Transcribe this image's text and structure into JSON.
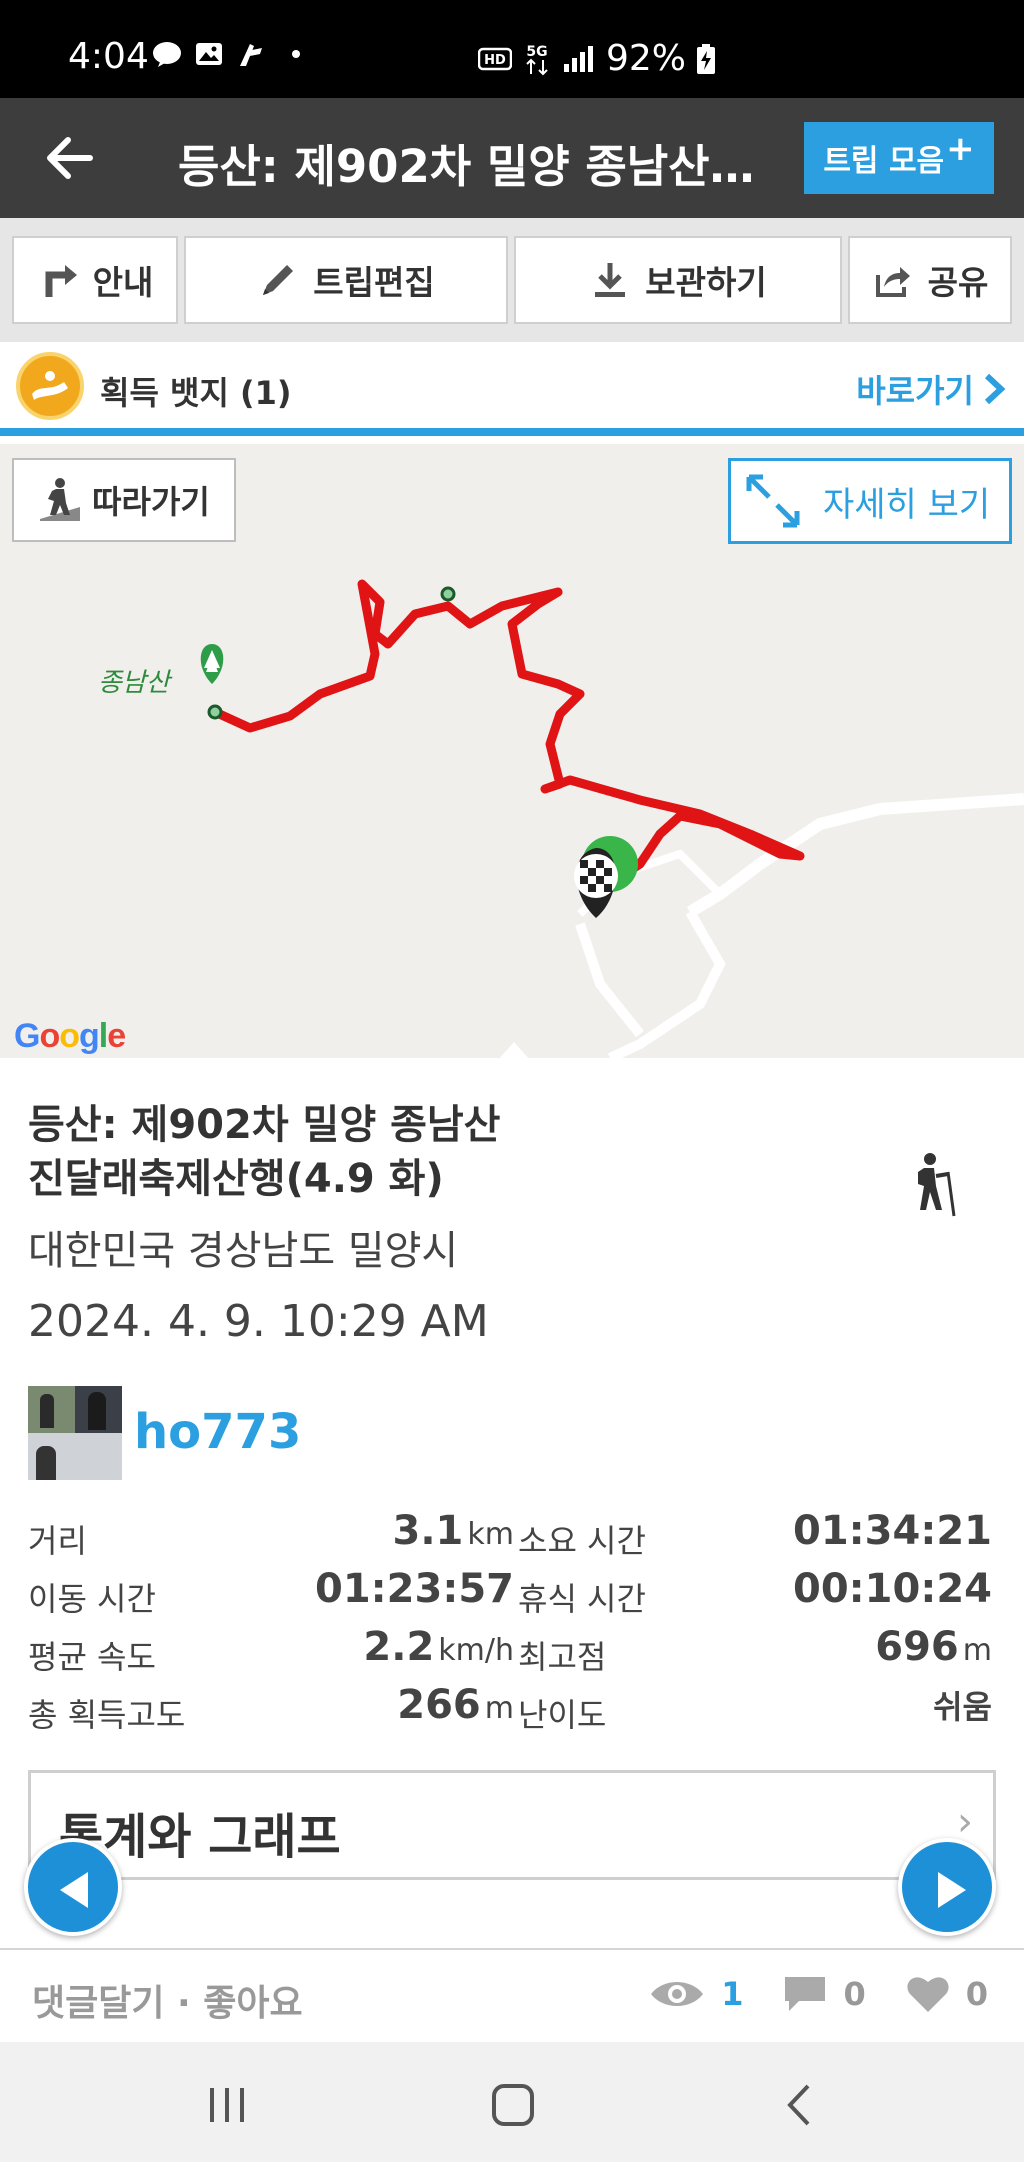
{
  "status_bar": {
    "time": "4:04",
    "battery": "92%",
    "network": "5G",
    "hd_label": "HD"
  },
  "header": {
    "title": "등산: 제902차 밀양 종남산...",
    "trip_collection_label": "트립 모음",
    "trip_collection_plus": "+"
  },
  "toolbar": {
    "guide": "안내",
    "edit": "트립편집",
    "save": "보관하기",
    "share": "공유"
  },
  "badge": {
    "label": "획득 뱃지 (1)",
    "link": "바로가기"
  },
  "map": {
    "follow": "따라가기",
    "detail_view": "자세히 보기",
    "poi_label": "종남산",
    "google": [
      "G",
      "o",
      "o",
      "g",
      "l",
      "e"
    ],
    "google_colors": [
      "#4285F4",
      "#EA4335",
      "#FBBC05",
      "#4285F4",
      "#34A853",
      "#EA4335"
    ],
    "route_color": "#e01414"
  },
  "trip": {
    "title_line1": "등산: 제902차 밀양 종남산",
    "title_line2": "진달래축제산행(4.9 화)",
    "location": "대한민국 경상남도 밀양시",
    "date": "2024. 4. 9. 10:29 AM",
    "user": "ho773",
    "activity_icon": "hiker-icon"
  },
  "stats": {
    "distance_label": "거리",
    "distance_value": "3.1",
    "distance_unit": "km",
    "total_time_label": "소요 시간",
    "total_time_value": "01:34:21",
    "moving_time_label": "이동 시간",
    "moving_time_value": "01:23:57",
    "rest_time_label": "휴식 시간",
    "rest_time_value": "00:10:24",
    "avg_speed_label": "평균 속도",
    "avg_speed_value": "2.2",
    "avg_speed_unit": "km/h",
    "max_alt_label": "최고점",
    "max_alt_value": "696",
    "max_alt_unit": "m",
    "elev_gain_label": "총 획득고도",
    "elev_gain_value": "266",
    "elev_gain_unit": "m",
    "difficulty_label": "난이도",
    "difficulty_value": "쉬움"
  },
  "stats_graph": {
    "label": "통계와 그래프",
    "chevron": "›"
  },
  "comments": {
    "link": "댓글달기 · 좋아요",
    "views": "1",
    "comments": "0",
    "likes": "0"
  }
}
